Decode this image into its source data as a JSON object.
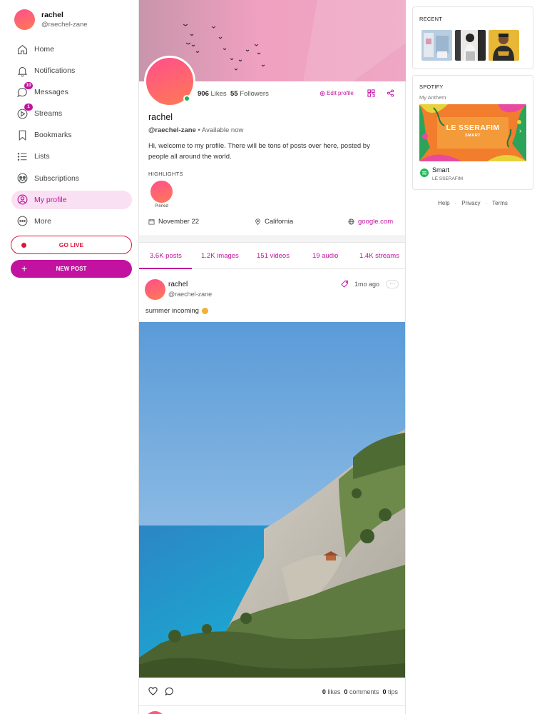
{
  "user": {
    "name": "rachel",
    "handle": "@raechel-zane"
  },
  "nav": {
    "home": "Home",
    "notifications": "Notifications",
    "messages": "Messages",
    "messages_badge": "10",
    "streams": "Streams",
    "streams_badge": "1",
    "bookmarks": "Bookmarks",
    "lists": "Lists",
    "subscriptions": "Subscriptions",
    "my_profile": "My profile",
    "more": "More"
  },
  "buttons": {
    "go_live": "GO LIVE",
    "new_post": "NEW POST",
    "new_post_icon": "+"
  },
  "profile": {
    "likes": "906",
    "likes_label": "Likes",
    "followers": "55",
    "followers_label": "Followers",
    "edit": "Edit profile",
    "name": "rachel",
    "handle": "@raechel-zane",
    "availability": "• Available now",
    "bio": "Hi, welcome to my profile. There will be tons of posts over here, posted by people all around the world.",
    "highlights_title": "HIGHLIGHTS",
    "highlight_label": "Pinned",
    "joined": "November 22",
    "location": "California",
    "website": "google.com"
  },
  "tabs": [
    {
      "label": "3.6K posts",
      "active": true
    },
    {
      "label": "1.2K images"
    },
    {
      "label": "151 videos"
    },
    {
      "label": "19 audio"
    },
    {
      "label": "1.4K streams"
    }
  ],
  "post": {
    "author": "rachel",
    "handle": "@raechel-zane",
    "time": "1mo ago",
    "more": "···",
    "text": "summer incoming",
    "likes_count": "0",
    "likes_label": "likes",
    "comments_count": "0",
    "comments_label": "comments",
    "tips_count": "0",
    "tips_label": "tips"
  },
  "recent": {
    "title": "RECENT"
  },
  "spotify": {
    "title": "SPOTIFY",
    "subtitle": "My Anthem",
    "album_artist": "LE SSERAFIM",
    "album_title": "SMART",
    "arrow": "›",
    "song": "Smart",
    "artist": "LE SSERAFIM"
  },
  "footer": {
    "help": "Help",
    "sep": "·",
    "privacy": "Privacy",
    "terms": "Terms"
  },
  "colors": {
    "accent": "#c0139e",
    "live": "#e0143c",
    "online": "#22b14c",
    "spotify": "#1db954"
  }
}
